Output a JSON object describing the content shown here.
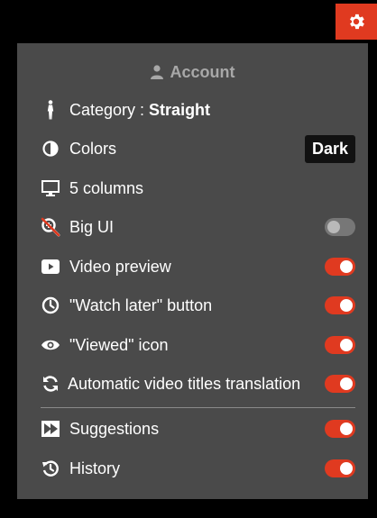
{
  "header": {
    "account_label": "Account"
  },
  "menu": {
    "category": {
      "label": "Category : ",
      "value": "Straight"
    },
    "colors": {
      "label": "Colors",
      "value": "Dark"
    },
    "columns": {
      "label": "5 columns"
    },
    "big_ui": {
      "label": "Big UI",
      "enabled": false
    },
    "video_preview": {
      "label": "Video preview",
      "enabled": true
    },
    "watch_later": {
      "label": "\"Watch later\" button",
      "enabled": true
    },
    "viewed_icon": {
      "label": "\"Viewed\" icon",
      "enabled": true
    },
    "auto_translation": {
      "label": "Automatic video titles translation",
      "enabled": true
    },
    "suggestions": {
      "label": "Suggestions",
      "enabled": true
    },
    "history": {
      "label": "History",
      "enabled": true
    }
  },
  "colors": {
    "accent": "#e03a20",
    "panel": "#4a4a4a",
    "toggle_off": "#777777"
  },
  "icons": [
    "gear-icon",
    "user-icon",
    "person-icon",
    "contrast-icon",
    "monitor-icon",
    "zoom-off-icon",
    "play-icon",
    "clock-icon",
    "eye-icon",
    "sync-icon",
    "forward-icon",
    "history-icon"
  ]
}
